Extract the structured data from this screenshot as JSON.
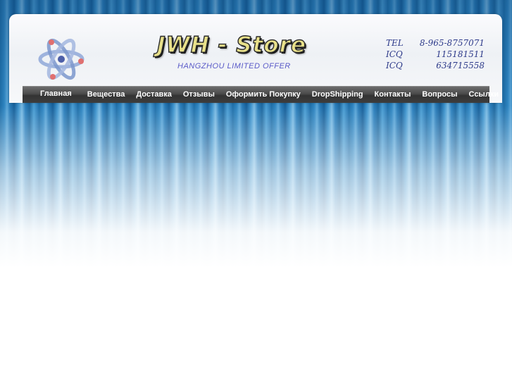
{
  "site": {
    "brand": "JWH - Store",
    "tagline": "HANGZHOU LIMITED OFFER"
  },
  "contacts": [
    {
      "label": "TEL",
      "value": "8-965-8757071"
    },
    {
      "label": "ICQ",
      "value": "115181511"
    },
    {
      "label": "ICQ",
      "value": "634715558"
    }
  ],
  "nav": {
    "items": [
      {
        "label": "Главная"
      },
      {
        "label": "Вещества"
      },
      {
        "label": "Доставка"
      },
      {
        "label": "Отзывы"
      },
      {
        "label": "Оформить Покупку"
      },
      {
        "label": "DropShipping"
      },
      {
        "label": "Контакты"
      },
      {
        "label": "Вопросы"
      },
      {
        "label": "Ссылки"
      }
    ]
  },
  "icons": {
    "logo": "atom-icon"
  },
  "colors": {
    "background_blue": "#2f86c2",
    "navbar": "#4a4a4a",
    "contact_text": "#2d3a8a",
    "tagline_text": "#5a5ac8",
    "brand_fill": "#e8e08a"
  }
}
